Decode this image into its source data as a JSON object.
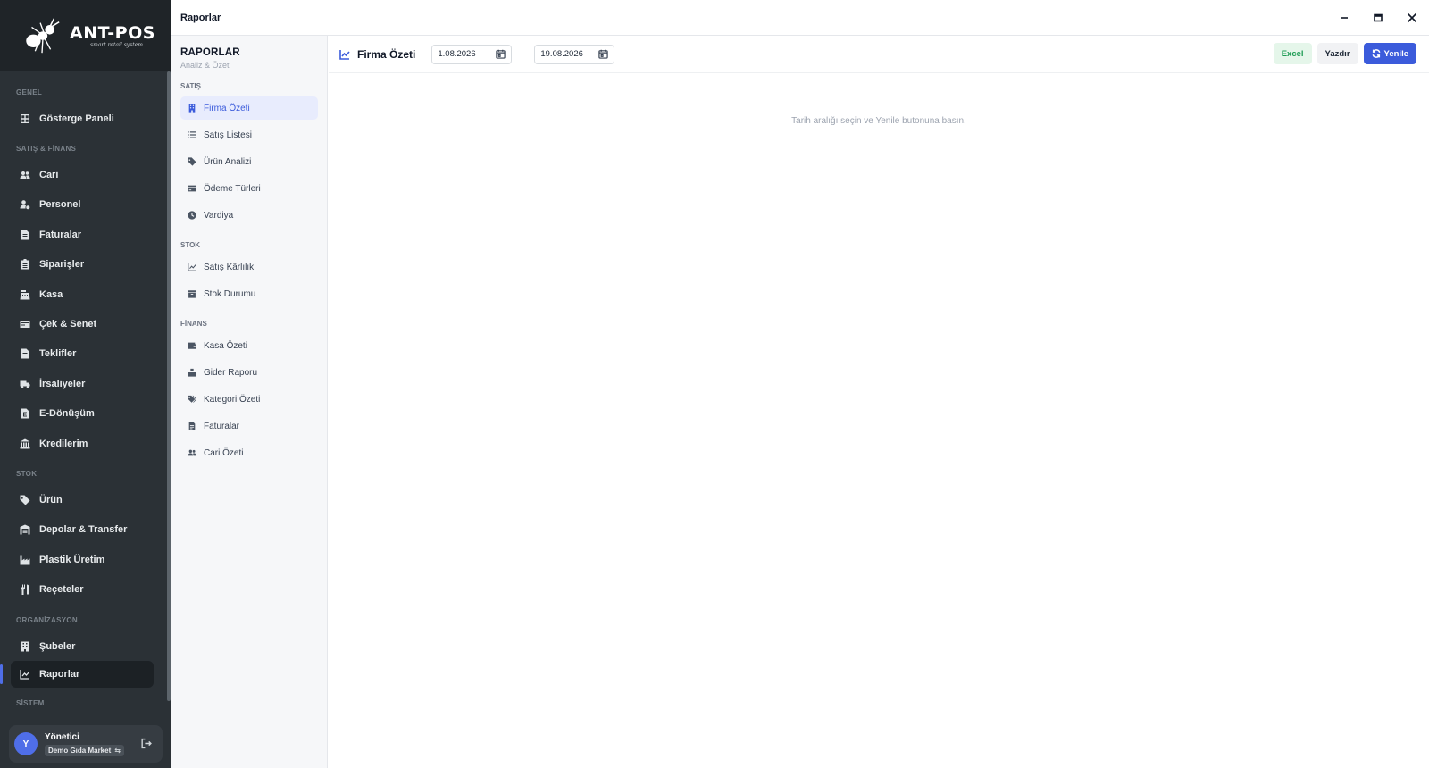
{
  "brand": {
    "name": "ANT-POS",
    "tagline": "smart retail system"
  },
  "window": {
    "title": "Raporlar"
  },
  "sidebar": {
    "sections": [
      {
        "label": "GENEL",
        "items": [
          {
            "label": "Gösterge Paneli",
            "icon": "dashboard-grid-icon"
          }
        ]
      },
      {
        "label": "SATIŞ & FİNANS",
        "items": [
          {
            "label": "Cari",
            "icon": "users-icon"
          },
          {
            "label": "Personel",
            "icon": "user-cog-icon"
          },
          {
            "label": "Faturalar",
            "icon": "invoice-icon"
          },
          {
            "label": "Siparişler",
            "icon": "clipboard-icon"
          },
          {
            "label": "Kasa",
            "icon": "cash-register-icon"
          },
          {
            "label": "Çek & Senet",
            "icon": "cheque-icon"
          },
          {
            "label": "Teklifler",
            "icon": "document-icon"
          },
          {
            "label": "İrsaliyeler",
            "icon": "truck-icon"
          },
          {
            "label": "E-Dönüşüm",
            "icon": "e-document-icon"
          },
          {
            "label": "Kredilerim",
            "icon": "bank-icon"
          }
        ]
      },
      {
        "label": "STOK",
        "items": [
          {
            "label": "Ürün",
            "icon": "tag-icon"
          },
          {
            "label": "Depolar & Transfer",
            "icon": "warehouse-icon"
          },
          {
            "label": "Plastik Üretim",
            "icon": "factory-icon"
          },
          {
            "label": "Reçeteler",
            "icon": "utensils-icon"
          }
        ]
      },
      {
        "label": "ORGANİZASYON",
        "items": [
          {
            "label": "Şubeler",
            "icon": "building-icon"
          },
          {
            "label": "Raporlar",
            "icon": "chart-line-icon",
            "active": true
          }
        ]
      },
      {
        "label": "SİSTEM",
        "items": []
      }
    ],
    "user": {
      "initial": "Y",
      "name": "Yönetici",
      "company": "Demo Gıda Market",
      "switch_glyph": "⇆"
    }
  },
  "report_menu": {
    "title": "RAPORLAR",
    "subtitle": "Analiz & Özet",
    "sections": [
      {
        "label": "SATIŞ",
        "items": [
          {
            "label": "Firma Özeti",
            "icon": "building-icon",
            "active": true
          },
          {
            "label": "Satış Listesi",
            "icon": "list-icon"
          },
          {
            "label": "Ürün Analizi",
            "icon": "tag-icon"
          },
          {
            "label": "Ödeme Türleri",
            "icon": "credit-card-icon"
          },
          {
            "label": "Vardiya",
            "icon": "clock-icon"
          }
        ]
      },
      {
        "label": "STOK",
        "items": [
          {
            "label": "Satış Kârlılık",
            "icon": "chart-line-icon"
          },
          {
            "label": "Stok Durumu",
            "icon": "box-icon"
          }
        ]
      },
      {
        "label": "FİNANS",
        "items": [
          {
            "label": "Kasa Özeti",
            "icon": "wallet-icon"
          },
          {
            "label": "Gider Raporu",
            "icon": "expense-icon"
          },
          {
            "label": "Kategori Özeti",
            "icon": "tags-icon"
          },
          {
            "label": "Faturalar",
            "icon": "invoice-icon"
          },
          {
            "label": "Cari Özeti",
            "icon": "users-icon"
          }
        ]
      }
    ]
  },
  "toolbar": {
    "title": "Firma Özeti",
    "date_from": "1.08.2026",
    "date_to": "19.08.2026",
    "excel_label": "Excel",
    "print_label": "Yazdır",
    "refresh_label": "Yenile"
  },
  "content": {
    "empty_message": "Tarih aralığı seçin ve Yenile butonuna basın."
  },
  "colors": {
    "accent": "#3b5bdb",
    "sidebar_bg": "#2b3136",
    "excel_green": "#1f9d55"
  }
}
